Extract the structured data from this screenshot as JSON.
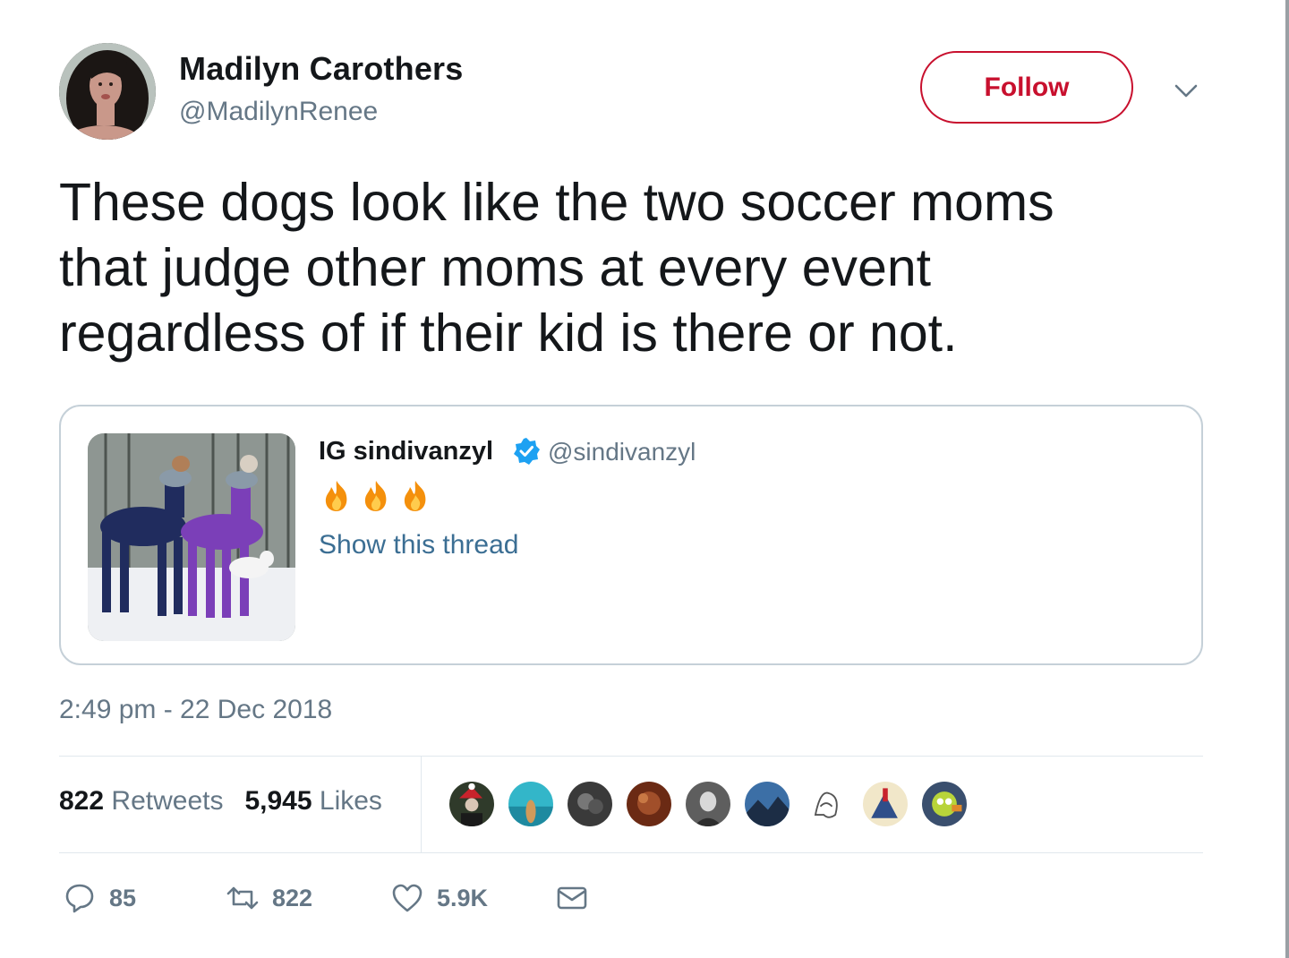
{
  "author": {
    "display_name": "Madilyn Carothers",
    "handle": "@MadilynRenee",
    "avatar_icon": "profile-photo"
  },
  "follow_button": {
    "label": "Follow",
    "color": "#c8102e"
  },
  "menu": {
    "icon": "chevron-down-icon"
  },
  "tweet": {
    "lines": [
      "These dogs look like the two soccer moms",
      "that judge other moms at every event",
      "regardless of if their kid is there or not."
    ]
  },
  "quoted_tweet": {
    "display_name": "IG sindivanzyl",
    "verified_icon": "verified-badge-icon",
    "handle": "@sindivanzyl",
    "emojis": [
      "fire-icon",
      "fire-icon",
      "fire-icon"
    ],
    "show_thread": "Show this thread",
    "image": "two-dogs-in-sweaters-photo"
  },
  "timestamp": "2:49 pm - 22 Dec 2018",
  "stats": {
    "retweets_count": "822",
    "retweets_label": "Retweets",
    "likes_count": "5,945",
    "likes_label": "Likes"
  },
  "actions": {
    "reply_count": "85",
    "retweet_count": "822",
    "like_count": "5.9K"
  },
  "colors": {
    "text": "#14171a",
    "secondary": "#657786",
    "link": "#3b6e93",
    "border": "#c5d0d8",
    "verified": "#1da1f2"
  }
}
